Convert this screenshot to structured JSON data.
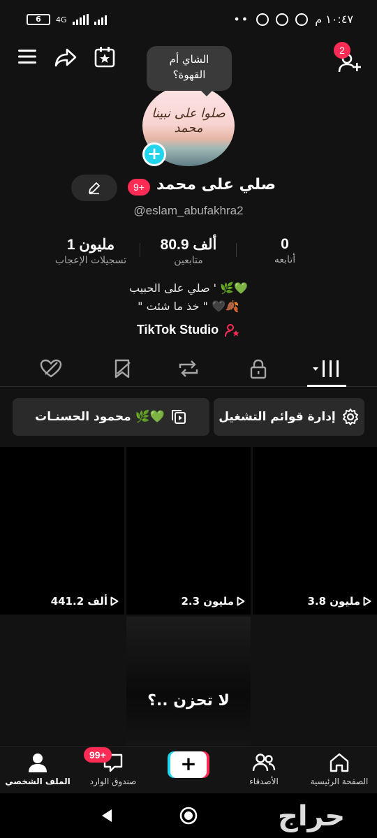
{
  "status_bar": {
    "time": "١٠:٤٧ م",
    "battery": "6",
    "network": "4G",
    "dots": "••"
  },
  "header": {
    "friend_requests_badge": "2"
  },
  "profile": {
    "note_bubble": "الشاي أم\nالقهوة؟",
    "avatar_caption": "صلوا على نبينا محمد",
    "name": "صلي على محمد",
    "notifications_badge": "9+",
    "username": "@eslam_abufakhra2"
  },
  "stats": [
    {
      "value": "0",
      "label": "أتابعه"
    },
    {
      "value": "80.9 ألف",
      "label": "متابعين"
    },
    {
      "value": "1 مليون",
      "label": "تسجيلات الإعجاب"
    }
  ],
  "bio": {
    "line1": "صلي على الحبيب ' 🌿💚",
    "line2": "\" خذ ما شئت \" 🖤🍂"
  },
  "studio_label": "TikTok Studio",
  "playlists": {
    "manage_label": "إدارة قوائم التشغيل",
    "playlist_label": "محمود الحسنـات 🌿💚"
  },
  "videos": [
    {
      "views": "3.8 مليون"
    },
    {
      "views": "2.3 مليون"
    },
    {
      "views": "441.2 ألف"
    },
    {
      "overlay_text": "لا تحزن ..؟"
    }
  ],
  "bottom_nav": {
    "home": "الصفحة الرئيسية",
    "friends": "الأصدقاء",
    "inbox": "صندوق الوارد",
    "inbox_badge": "99+",
    "profile": "الملف الشخصي"
  },
  "colors": {
    "accent": "#fe2c55",
    "cyan": "#20d5ec",
    "background": "#121212"
  },
  "watermark": "حراج"
}
